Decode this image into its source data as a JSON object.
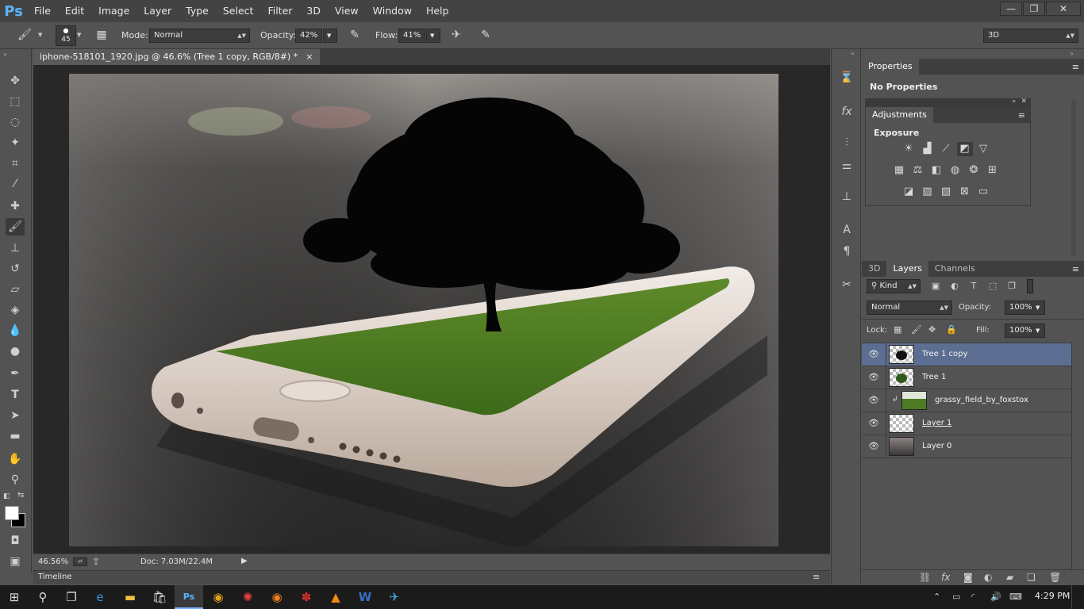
{
  "menubar": {
    "logo": "Ps",
    "items": [
      "File",
      "Edit",
      "Image",
      "Layer",
      "Type",
      "Select",
      "Filter",
      "3D",
      "View",
      "Window",
      "Help"
    ]
  },
  "options": {
    "brush_size": "45",
    "mode_label": "Mode:",
    "mode_value": "Normal",
    "opacity_label": "Opacity:",
    "opacity_value": "42%",
    "flow_label": "Flow:",
    "flow_value": "41%",
    "workspace": "3D"
  },
  "document": {
    "tab_title": "iphone-518101_1920.jpg @ 46.6% (Tree 1 copy, RGB/8#) *",
    "close": "×"
  },
  "status": {
    "zoom": "46.56%",
    "doc_size": "Doc: 7.03M/22.4M"
  },
  "timeline": {
    "label": "Timeline"
  },
  "properties": {
    "tab": "Properties",
    "content": "No Properties"
  },
  "adjustments": {
    "tab": "Adjustments",
    "current": "Exposure"
  },
  "layers_panel": {
    "tabs": [
      "3D",
      "Layers",
      "Channels"
    ],
    "kind": "Kind",
    "blend_mode": "Normal",
    "opacity_label": "Opacity:",
    "opacity_value": "100%",
    "lock_label": "Lock:",
    "fill_label": "Fill:",
    "fill_value": "100%",
    "layers": [
      {
        "name": "Tree 1 copy"
      },
      {
        "name": "Tree 1"
      },
      {
        "name": "grassy_field_by_foxstox"
      },
      {
        "name": "Layer 1"
      },
      {
        "name": "Layer 0"
      }
    ]
  },
  "taskbar": {
    "time": "4:29 PM"
  }
}
